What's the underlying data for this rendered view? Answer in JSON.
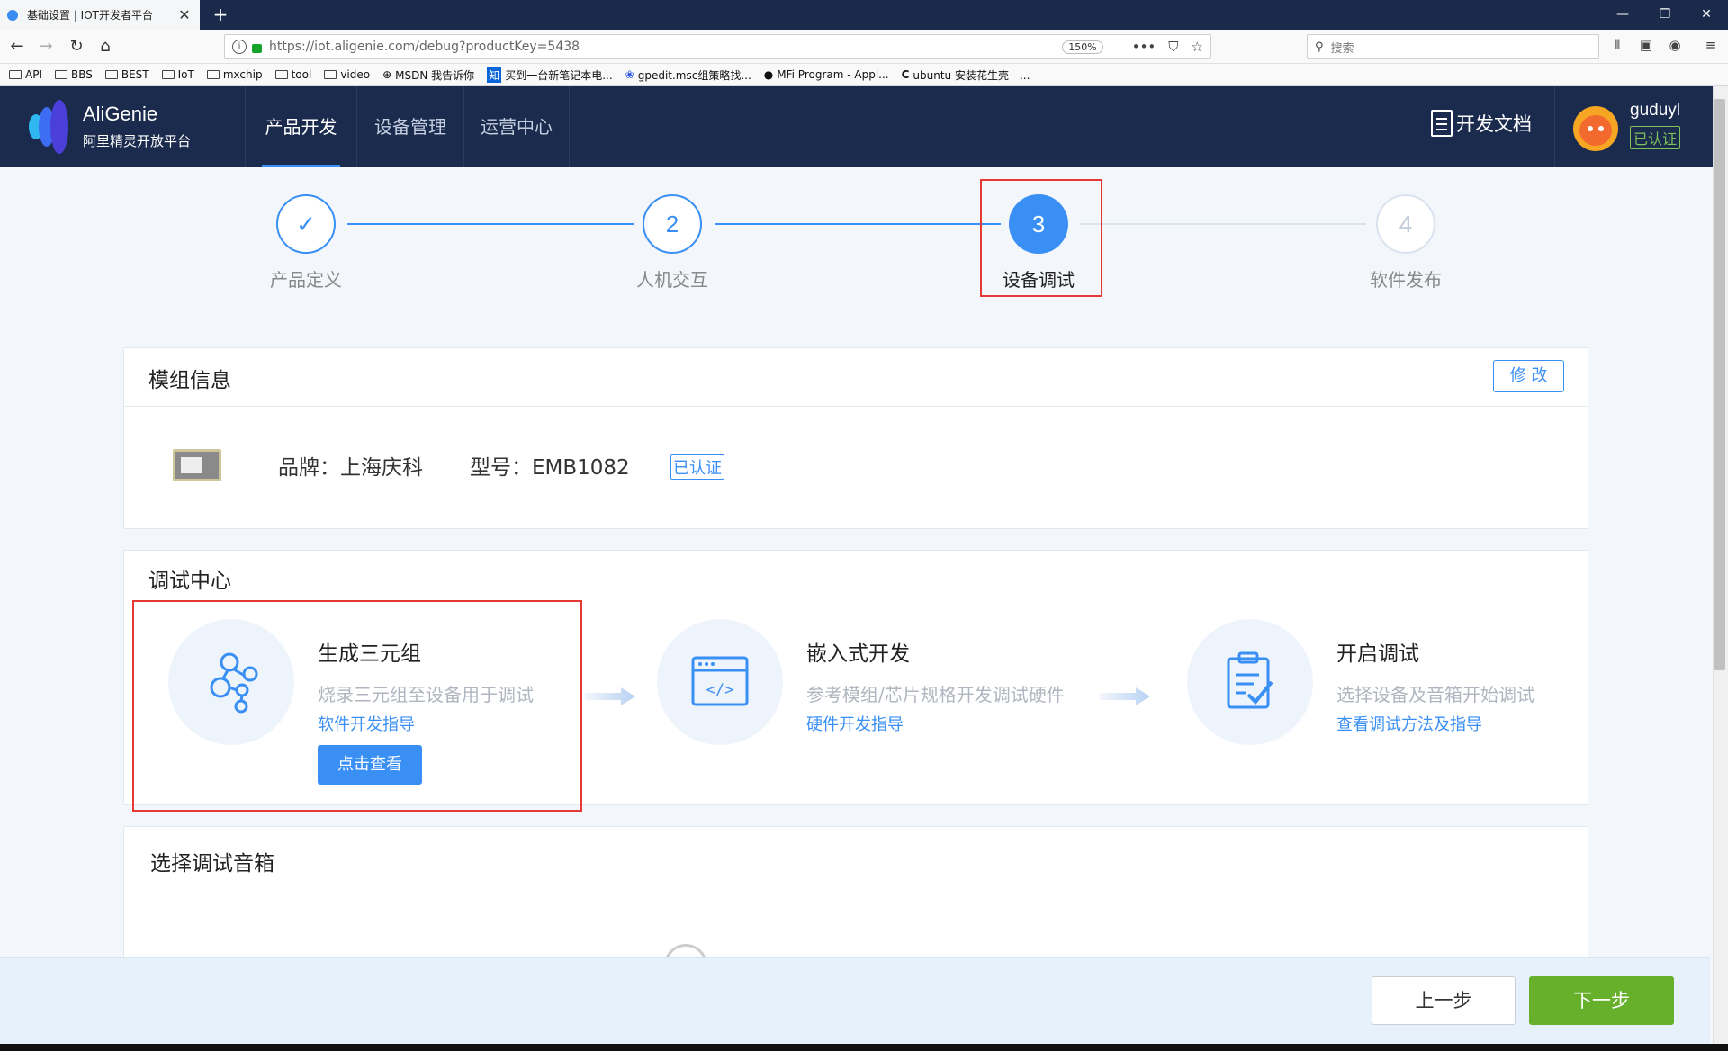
{
  "browser": {
    "tab_title": "基础设置 | IOT开发者平台",
    "tab_close": "✕",
    "new_tab": "+",
    "url": "https://iot.aligenie.com/debug?productKey=5438",
    "zoom": "150%",
    "search_placeholder": "搜索",
    "bookmarks": [
      "API",
      "BBS",
      "BEST",
      "IoT",
      "mxchip",
      "tool",
      "video",
      "MSDN 我告诉你",
      "买到一台新笔记本电...",
      "gpedit.msc组策略找...",
      "MFi Program - Appl...",
      "ubuntu 安装花生壳 - ..."
    ],
    "win_min": "—",
    "win_max": "❐",
    "win_close": "✕"
  },
  "header": {
    "brand_title": "AliGenie",
    "brand_sub": "阿里精灵开放平台",
    "nav": [
      "产品开发",
      "设备管理",
      "运营中心"
    ],
    "dev_doc": "开发文档",
    "username": "guduyl",
    "verified": "已认证"
  },
  "steps": [
    {
      "num": "✓",
      "label": "产品定义",
      "state": "done"
    },
    {
      "num": "2",
      "label": "人机交互",
      "state": "done"
    },
    {
      "num": "3",
      "label": "设备调试",
      "state": "current"
    },
    {
      "num": "4",
      "label": "软件发布",
      "state": "todo"
    }
  ],
  "module_info": {
    "title": "模组信息",
    "edit": "修 改",
    "brand": "品牌：上海庆科",
    "model": "型号：EMB1082",
    "verified": "已认证"
  },
  "debug_center": {
    "title": "调试中心",
    "items": [
      {
        "title": "生成三元组",
        "desc": "烧录三元组至设备用于调试",
        "link": "软件开发指导",
        "button": "点击查看"
      },
      {
        "title": "嵌入式开发",
        "desc": "参考模组/芯片规格开发调试硬件",
        "link": "硬件开发指导"
      },
      {
        "title": "开启调试",
        "desc": "选择设备及音箱开始调试",
        "link": "查看调试方法及指导"
      }
    ]
  },
  "speaker": {
    "title": "选择调试音箱"
  },
  "footer": {
    "prev": "上一步",
    "next": "下一步"
  },
  "colors": {
    "accent": "#3a8ff5",
    "header_bg": "#1b2b4d",
    "next_button": "#67b02c",
    "highlight": "#e53935"
  }
}
